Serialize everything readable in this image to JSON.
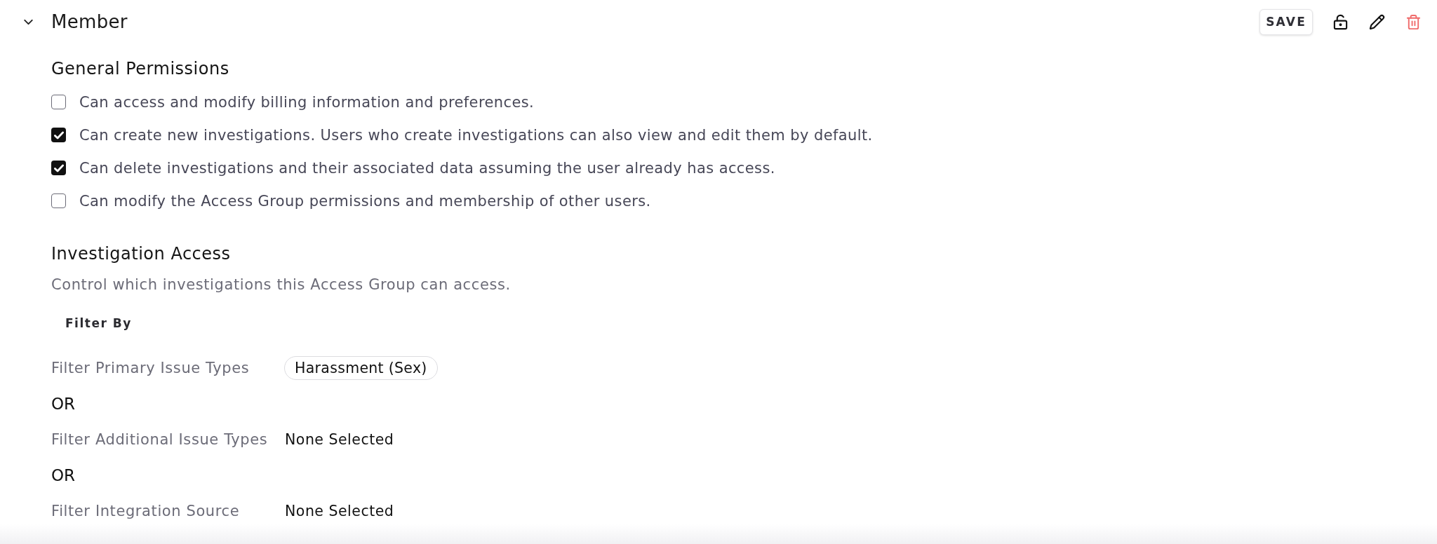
{
  "section": {
    "title": "Member",
    "expanded": true
  },
  "actions": {
    "save": "SAVE"
  },
  "general_permissions": {
    "title": "General Permissions",
    "items": [
      {
        "label": "Can access and modify billing information and preferences.",
        "checked": false
      },
      {
        "label": "Can create new investigations. Users who create investigations can also view and edit them by default.",
        "checked": true
      },
      {
        "label": "Can delete investigations and their associated data assuming the user already has access.",
        "checked": true
      },
      {
        "label": "Can modify the Access Group permissions and membership of other users.",
        "checked": false
      }
    ]
  },
  "investigation_access": {
    "title": "Investigation Access",
    "description": "Control which investigations this Access Group can access.",
    "filter_by": "Filter By",
    "filters": [
      {
        "kind": "filter",
        "label": "Filter Primary Issue Types",
        "chips": [
          "Harassment (Sex)"
        ]
      },
      {
        "kind": "operator",
        "text": "OR"
      },
      {
        "kind": "filter",
        "label": "Filter Additional Issue Types",
        "value": "None Selected"
      },
      {
        "kind": "operator",
        "text": "OR"
      },
      {
        "kind": "filter",
        "label": "Filter Integration Source",
        "value": "None Selected"
      }
    ]
  }
}
